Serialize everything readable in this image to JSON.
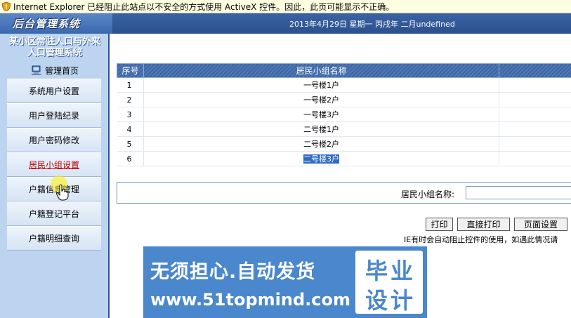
{
  "ie_bar": {
    "message": "Internet Explorer 已经阻止此站点以不安全的方式使用 ActiveX 控件。因此，此页可能显示不正确。"
  },
  "header": {
    "logo": "后台管理系统",
    "date_text": "2013年4月29日 星期一 丙戌年 二月undefined"
  },
  "sidebar": {
    "system_title_line1": "某小区常驻人口与外来",
    "system_title_line2": "人口管理系统",
    "home_label": "管理首页",
    "items": [
      {
        "label": "系统用户设置"
      },
      {
        "label": "用户登陆纪录"
      },
      {
        "label": "用户密码修改"
      },
      {
        "label": "居民小组设置",
        "active": true
      },
      {
        "label": "户籍信息管理"
      },
      {
        "label": "户籍登记平台"
      },
      {
        "label": "户籍明细查询"
      }
    ]
  },
  "grid": {
    "columns": [
      "序号",
      "居民小组名称",
      ""
    ],
    "rows": [
      {
        "no": "1",
        "name": "一号楼1户"
      },
      {
        "no": "2",
        "name": "一号楼2户"
      },
      {
        "no": "3",
        "name": "一号楼3户"
      },
      {
        "no": "4",
        "name": "二号楼1户"
      },
      {
        "no": "5",
        "name": "二号楼2户"
      },
      {
        "no": "6",
        "name": "二号楼3户",
        "selected": true
      }
    ]
  },
  "form": {
    "group_name_label": "居民小组名称:",
    "group_name_value": ""
  },
  "print": {
    "print_label": "打印",
    "direct_print_label": "直接打印",
    "page_setup_label": "页面设置",
    "note": "IE有时会自动阻止控件的使用，如遇此情况请"
  },
  "banner": {
    "slogan": "无须担心.自动发货",
    "url": "www.51topmind.com",
    "stamp_line1": "毕业",
    "stamp_line2": "设计"
  },
  "colors": {
    "header_blue": "#2b4f8e",
    "sidebar_bg": "#bcd4ef",
    "active_menu": "#c00000",
    "selection": "#316ac5",
    "banner_blue": "#4a87cc"
  }
}
